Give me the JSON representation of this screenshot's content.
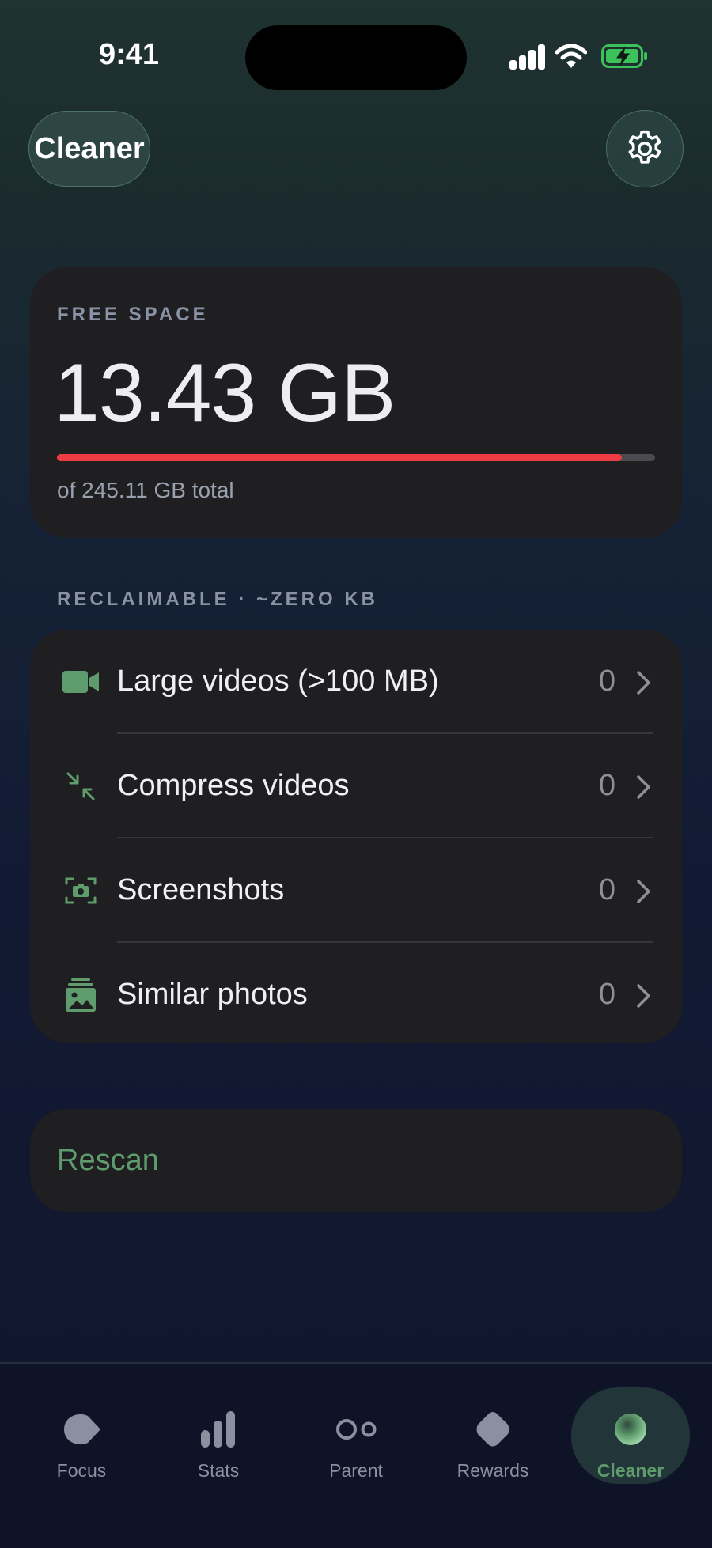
{
  "status_bar": {
    "time": "9:41"
  },
  "header": {
    "title": "Cleaner",
    "settings_icon": "gear-icon"
  },
  "free_space": {
    "label": "FREE SPACE",
    "value": "13.43 GB",
    "used_fraction": 0.945,
    "total_text": "of 245.11 GB total",
    "bar_color": "#ef3b43"
  },
  "reclaimable": {
    "label": "RECLAIMABLE · ~ZERO KB",
    "items": [
      {
        "label": "Large videos (>100 MB)",
        "count": "0",
        "icon": "video-camera-icon"
      },
      {
        "label": "Compress videos",
        "count": "0",
        "icon": "compress-arrows-icon"
      },
      {
        "label": "Screenshots",
        "count": "0",
        "icon": "screenshot-camera-icon"
      },
      {
        "label": "Similar photos",
        "count": "0",
        "icon": "photo-stack-icon"
      }
    ]
  },
  "rescan": {
    "label": "Rescan"
  },
  "tabs": [
    {
      "label": "Focus",
      "icon": "focus-icon",
      "active": false
    },
    {
      "label": "Stats",
      "icon": "bar-chart-icon",
      "active": false
    },
    {
      "label": "Parent",
      "icon": "parent-circles-icon",
      "active": false
    },
    {
      "label": "Rewards",
      "icon": "diamond-icon",
      "active": false
    },
    {
      "label": "Cleaner",
      "icon": "cleaner-orb-icon",
      "active": true
    }
  ],
  "colors": {
    "accent": "#5f9c6d",
    "warning": "#ef3b43"
  }
}
